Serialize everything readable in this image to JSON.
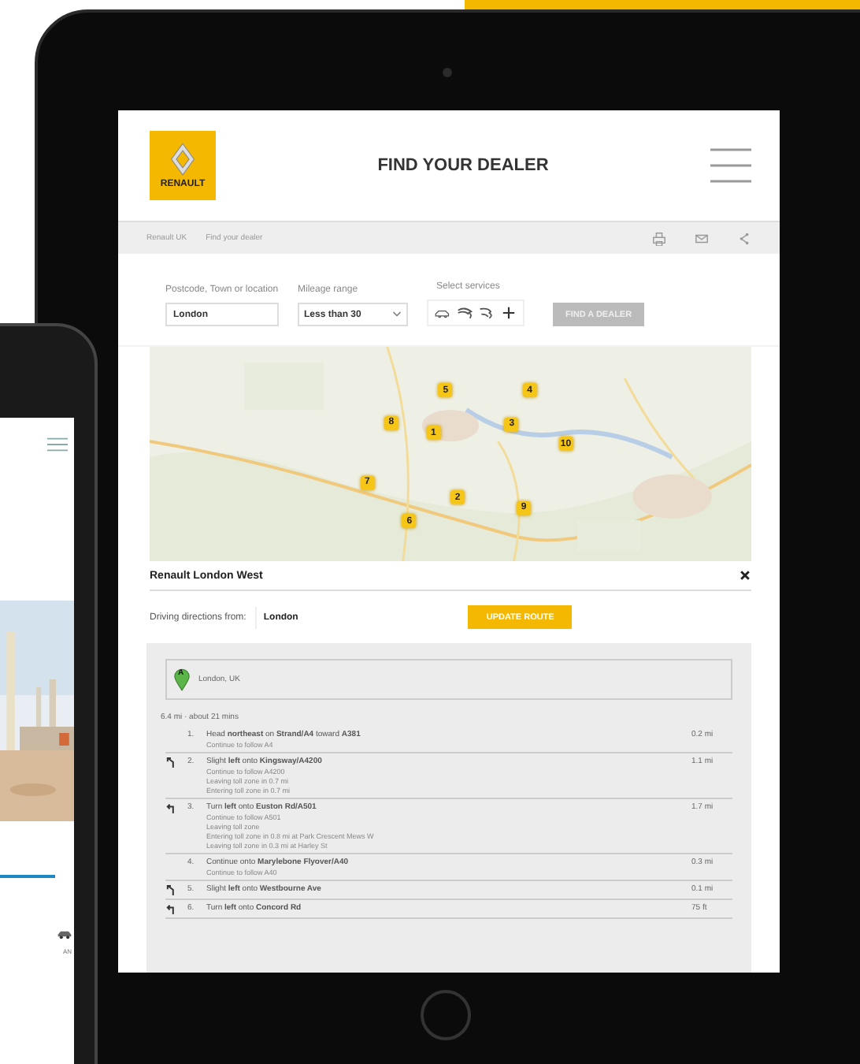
{
  "tablet": {
    "header": {
      "logo_text": "RENAULT",
      "title": "FIND YOUR DEALER"
    },
    "breadcrumb": [
      "Renault UK",
      "Find your dealer"
    ],
    "search": {
      "location": {
        "label": "Postcode, Town or location",
        "value": "London"
      },
      "mileage": {
        "label": "Mileage range",
        "value": "Less than 30"
      },
      "services": {
        "label": "Select services"
      },
      "button": "FIND A DEALER"
    },
    "map": {
      "markers": [
        {
          "label": "8"
        },
        {
          "label": "5"
        },
        {
          "label": "4"
        },
        {
          "label": "1"
        },
        {
          "label": "3"
        },
        {
          "label": "10"
        },
        {
          "label": "7"
        },
        {
          "label": "2"
        },
        {
          "label": "9"
        },
        {
          "label": "6"
        }
      ]
    },
    "dealer": {
      "title": "Renault London West",
      "directions_label": "Driving directions from:",
      "from_value": "London",
      "update_button": "UPDATE ROUTE",
      "start_marker": "A",
      "start": "London, UK",
      "summary": "6.4 mi · about 21 mins",
      "steps": [
        {
          "number": "1.",
          "kind": "straight",
          "text": "Head **northeast** on **Strand/A4** toward **A381**",
          "notes": [
            "Continue to follow A4"
          ],
          "distance": "0.2 mi"
        },
        {
          "number": "2.",
          "kind": "slight-left",
          "text": "Slight **left** onto **Kingsway/A4200**",
          "notes": [
            "Continue to follow A4200",
            "Leaving toll zone in 0.7 mi",
            "Entering toll zone in 0.7 mi"
          ],
          "distance": "1.1 mi"
        },
        {
          "number": "3.",
          "kind": "left",
          "text": "Turn **left** onto **Euston Rd/A501**",
          "notes": [
            "Continue to follow A501",
            "Leaving toll zone",
            "Entering toll zone in 0.8 mi at Park Crescent Mews W",
            "Leaving toll zone in 0.3 mi at Harley St"
          ],
          "distance": "1.7 mi"
        },
        {
          "number": "4.",
          "kind": "straight",
          "text": "Continue onto **Marylebone Flyover/A40**",
          "notes": [
            "Continue to follow A40"
          ],
          "distance": "0.3 mi"
        },
        {
          "number": "5.",
          "kind": "slight-left",
          "text": "Slight **left** onto **Westbourne Ave**",
          "distance": "0.1 mi"
        },
        {
          "number": "6.",
          "kind": "left",
          "text": "Turn **left** onto **Concord Rd**",
          "distance": "75 ft"
        }
      ]
    }
  },
  "phone": {
    "partial_label": "AN"
  }
}
